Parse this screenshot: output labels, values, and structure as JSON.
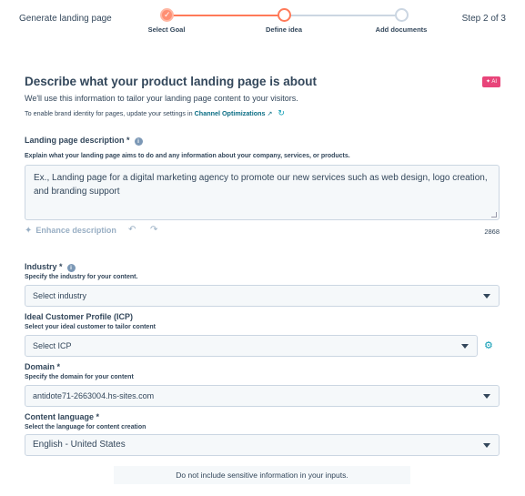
{
  "header": {
    "title": "Generate landing page",
    "step_counter": "Step 2 of 3",
    "steps": [
      {
        "label": "Select Goal",
        "state": "done"
      },
      {
        "label": "Define idea",
        "state": "active"
      },
      {
        "label": "Add documents",
        "state": "todo"
      }
    ]
  },
  "section": {
    "title": "Describe what your product landing page is about",
    "ai_badge": "✦ AI",
    "subtitle": "We'll use this information to tailor your landing page content to your visitors.",
    "brand_note_prefix": "To enable brand identity for pages, update your settings in ",
    "brand_note_link": "Channel Optimizations"
  },
  "description_field": {
    "label": "Landing page description *",
    "help": "Explain what your landing page aims to do and any information about your company, services, or products.",
    "placeholder": "Ex., Landing page for a digital marketing agency to promote our new services such as web design, logo creation, and branding support",
    "enhance_label": "Enhance description",
    "char_count": "2868"
  },
  "industry_field": {
    "label": "Industry *",
    "help": "Specify the industry for your content.",
    "value": "Select industry"
  },
  "icp_field": {
    "label": "Ideal Customer Profile (ICP)",
    "help": "Select your ideal customer to tailor content",
    "value": "Select ICP"
  },
  "domain_field": {
    "label": "Domain *",
    "help": "Specify the domain for your content",
    "value": "antidote71-2663004.hs-sites.com"
  },
  "language_field": {
    "label": "Content language *",
    "help": "Select the language for content creation",
    "value": "English - United States"
  },
  "notice": "Do not include sensitive information in your inputs.",
  "colors": {
    "accent": "#ff7a59",
    "link": "#0a6d84",
    "ai_badge": "#e8457a",
    "field_bg": "#f5f8fa",
    "border": "#cbd6e2"
  },
  "icons": {
    "check": "check-icon",
    "info": "info-icon",
    "external": "external-link-icon",
    "refresh": "refresh-icon",
    "sparkle": "sparkle-icon",
    "undo": "undo-icon",
    "redo": "redo-icon",
    "caret": "chevron-down-icon",
    "gear": "gear-icon"
  }
}
